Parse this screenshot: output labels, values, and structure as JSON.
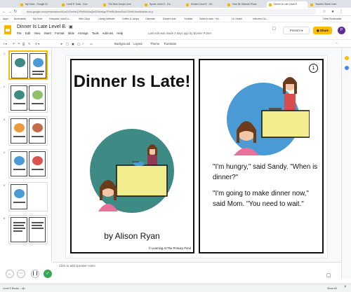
{
  "browser": {
    "tabs": [
      {
        "label": "My Drive - Google Dr"
      },
      {
        "label": "Level E Tools - Goo"
      },
      {
        "label": "The Best Jumps Leve"
      },
      {
        "label": "Sports Level E - Go"
      },
      {
        "label": "Kristen Level E - Go"
      },
      {
        "label": "How Mr. Mancini Plans"
      },
      {
        "label": "Dinner is Late Level E"
      },
      {
        "label": "Teacher Sheet Leve"
      }
    ],
    "url": "docs.google.com/presentation/d/1w2V2mHeQXPbBN4NaQbSD9hz6ga7Pb6BUBnbd3xkCONHIUt/edit#slide=id.p",
    "bookmarks": [
      "Apps",
      "Bookmarks",
      "My Drive",
      "Hotspace | Adult Li...",
      "Wiki Cloud",
      "Library Website",
      "Coffee & Jumps",
      "Calendar",
      "Eastern Arts",
      "Youtube",
      "Safari in dark - Ha...",
      "Lit, Kindle",
      "Interview Gu...",
      "Other Bookmarks"
    ]
  },
  "docs": {
    "title": "Dinner Is Late Level E",
    "menus": [
      "File",
      "Edit",
      "View",
      "Insert",
      "Format",
      "Slide",
      "Arrange",
      "Tools",
      "Add-ons",
      "Help"
    ],
    "last_edit": "Last edit was made 2 days ago by Bonnie Porter",
    "present_label": "Present",
    "share_label": "Share",
    "avatar_letter": "P",
    "toolbar": [
      "Background",
      "Layout",
      "Theme",
      "Transition"
    ]
  },
  "filmstrip": [
    {
      "num": "1"
    },
    {
      "num": "2"
    },
    {
      "num": "3"
    },
    {
      "num": "4"
    },
    {
      "num": "5"
    },
    {
      "num": "6"
    }
  ],
  "slide": {
    "cover_title": "Dinner Is Late!",
    "cover_author": "by Alison Ryan",
    "cover_credit": "© Learning At The Primary Pond",
    "page_number": "1",
    "story_1": "\"I'm hungry,\" said Sandy. \"When is dinner?\"",
    "story_2": "\"I'm going to make dinner now,\" said Mom. \"You need to wait.\""
  },
  "notes_placeholder": "Click to add speaker notes",
  "statusbar": {
    "download": "Level E Books ...zip",
    "show_all": "Show All"
  },
  "colors": {
    "accent": "#fbbc04",
    "background_circle": "#4a9bd5",
    "counter_yellow": "#f2ed8c",
    "teal": "#3e8a85"
  }
}
